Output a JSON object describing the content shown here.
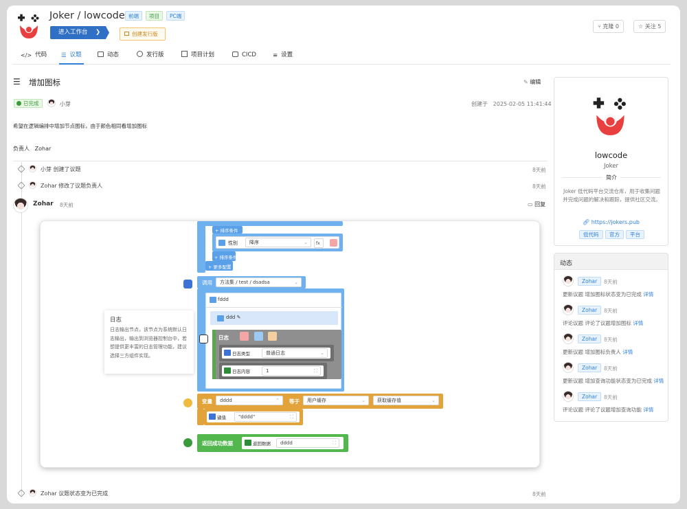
{
  "header": {
    "repo_owner": "Joker",
    "repo_sep": " / ",
    "repo_name": "lowcode",
    "tags": [
      "前端",
      "项目",
      "PC端"
    ],
    "enter_workbench": "进入工作台",
    "create_release": "创建发行版",
    "fork_label": "克隆",
    "fork_count": "0",
    "star_label": "关注",
    "star_count": "5"
  },
  "tabs": [
    {
      "label": "代码",
      "icon": "code-icon"
    },
    {
      "label": "议题",
      "icon": "issue-list-icon"
    },
    {
      "label": "动态",
      "icon": "message-icon"
    },
    {
      "label": "发行版",
      "icon": "info-icon"
    },
    {
      "label": "项目计划",
      "icon": "calendar-icon"
    },
    {
      "label": "CICD",
      "icon": "cicd-icon"
    },
    {
      "label": "设置",
      "icon": "settings-icon"
    }
  ],
  "issue": {
    "title": "增加图标",
    "edit": "编辑",
    "status": "已完成",
    "author": "小芽",
    "created_label": "创建于",
    "created_at": "2025-02-05 11:41:44",
    "description": "希望在逻辑编排中增加节点图标，由于颜色相同看增加图标",
    "assignee_label": "负责人",
    "assignee": "Zohar"
  },
  "timeline": {
    "e1_user": "小芽",
    "e1_action": "创建了议题",
    "e1_time": "8天前",
    "e2_user": "Zohar",
    "e2_action": "修改了议题负责人",
    "e2_time": "8天前",
    "comment_user": "Zohar",
    "comment_time": "8天前",
    "reply": "回复",
    "e3_user": "Zohar",
    "e3_action": "议题状态变为已完成",
    "e3_time": "8天前"
  },
  "flow": {
    "sort_cond1": "+ 排序条件",
    "field_gender": "性别",
    "order_value": "降序",
    "fx": "fx",
    "sort_cond2": "+ 排序条件",
    "more_config": "+ 更多配置",
    "call_label": "调用",
    "call_value": "方法集 / test / dsadsa",
    "fddd": "fddd",
    "ddd": "ddd",
    "log_label": "日志",
    "log_type_label": "日志类型",
    "log_type_value": "普通日志",
    "log_content_label": "日志内容",
    "log_content_value": "1",
    "var_label": "变量",
    "var_value": "dddd",
    "eq_label": "等于",
    "user_cache": "用户缓存",
    "get_cache": "获取缓存值",
    "key_label": "键值",
    "key_value": "\"dddd\"",
    "return_label": "返回成功数据",
    "return_data_label": "返回数据",
    "return_data_value": "dddd",
    "tip_title": "日志",
    "tip_body": "日志输出节点，该节点为系统默认日志输出，输出到浏览器控制台中，若想提供更丰富的日志管理功能，建议选择三方组件实现。"
  },
  "sidebar": {
    "name": "lowcode",
    "owner": "Joker",
    "intro_label": "简介",
    "intro": "Joker 低代码平台交流仓库，用于收集问题并完成问题的解决和跟踪，提供社区交流。",
    "link": "https://jokers.pub",
    "tags": [
      "低代码",
      "官方",
      "平台"
    ]
  },
  "activity": {
    "title": "动态",
    "items": [
      {
        "user": "Zohar",
        "time": "8天前",
        "text": "更新议题 增加图标状态变为已完成",
        "detail": "详情"
      },
      {
        "user": "Zohar",
        "time": "8天前",
        "text": "评论议题 评论了议题增加图标",
        "detail": "详情"
      },
      {
        "user": "Zohar",
        "time": "8天前",
        "text": "更新议题 增加图标负责人",
        "detail": "详情"
      },
      {
        "user": "Zohar",
        "time": "8天前",
        "text": "更新议题 增加查询功能状态变为已完成",
        "detail": "详情"
      },
      {
        "user": "Zohar",
        "time": "8天前",
        "text": "评论议题 评论了议题增加查询功能",
        "detail": "详情"
      }
    ]
  },
  "colors": {
    "primary": "#2f80d6",
    "success": "#3a9b3a",
    "flow_blue": "#6fb0ef",
    "flow_orange": "#e3a33b",
    "flow_green": "#52b84e"
  }
}
